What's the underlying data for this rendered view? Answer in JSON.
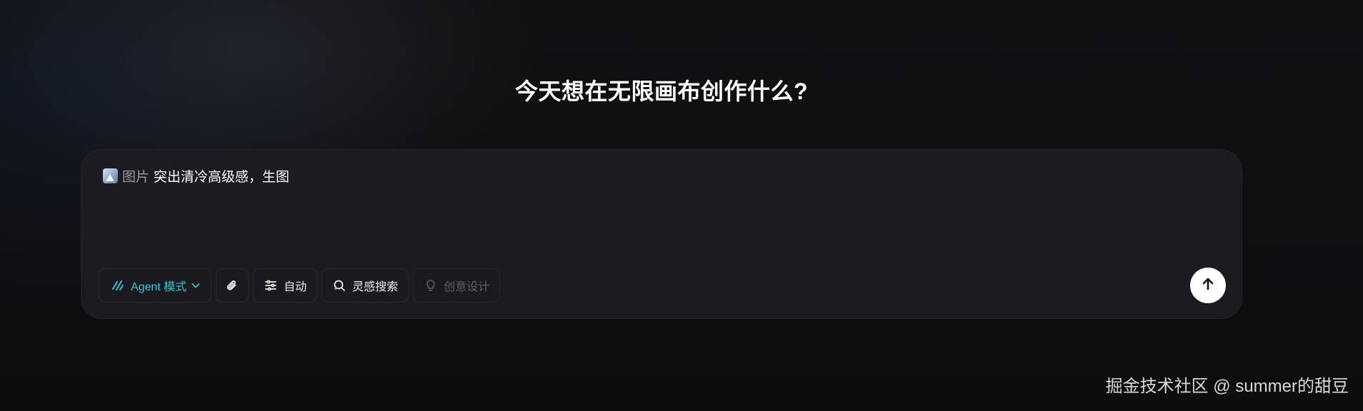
{
  "headline": "今天想在无限画布创作什么?",
  "composer": {
    "attachment_tag": "图片",
    "attachment_icon": "image-thumbnail-icon",
    "prompt_text": "突出清冷高级感，生图"
  },
  "toolbar": {
    "agent_mode_label": "Agent 模式",
    "attach_icon": "paperclip-icon",
    "auto_label": "自动",
    "inspiration_search_label": "灵感搜索",
    "creative_design_label": "创意设计"
  },
  "send_icon": "arrow-up-icon",
  "watermark": "掘金技术社区 @ summer的甜豆",
  "colors": {
    "accent": "#2fc7d4",
    "background": "#0f0f12",
    "panel": "#1c1c20",
    "send_button": "#ffffff"
  }
}
